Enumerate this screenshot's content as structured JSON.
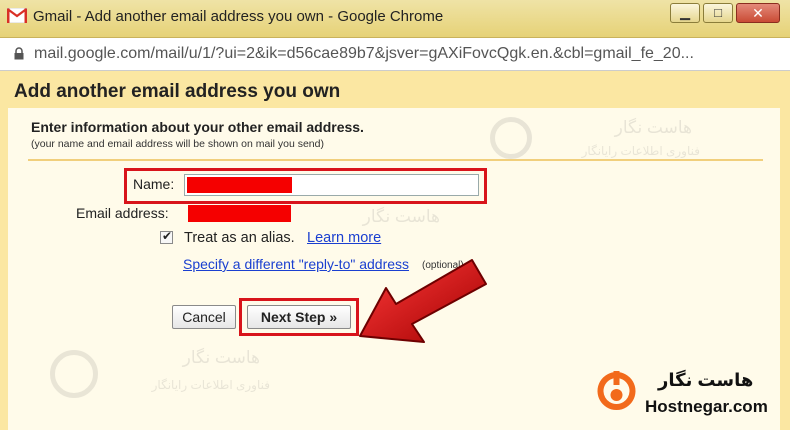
{
  "window": {
    "title": "Gmail - Add another email address you own - Google Chrome",
    "controls": [
      "minimize-icon",
      "maximize-icon",
      "close-icon"
    ]
  },
  "addressbar": {
    "url": "mail.google.com/mail/u/1/?ui=2&ik=d56cae89b7&jsver=gAXiFovcQgk.en.&cbl=gmail_fe_20..."
  },
  "dialog": {
    "title": "Add another email address you own",
    "heading": "Enter information about your other email address.",
    "subnote": "(your name and email address will be shown on mail you send)",
    "name_label": "Name:",
    "name_value": "",
    "email_label": "Email address:",
    "email_value": "",
    "alias_checked": true,
    "alias_label": "Treat as an alias.",
    "learn_more": "Learn more",
    "reply_to_link": "Specify a different \"reply-to\" address",
    "optional_note": "(optional)",
    "cancel_label": "Cancel",
    "next_label": "Next Step »"
  },
  "annotations": {
    "highlight_color": "#d8141b",
    "redaction_color": "#f50000"
  },
  "watermark": {
    "name_fa": "هاست نگار",
    "tagline_fa": "فناوری اطلاعات رایانگار"
  },
  "brand": {
    "name_fa": "هاست نگار",
    "name_en": "Hostnegar.com",
    "accent": "#f26a1b"
  }
}
